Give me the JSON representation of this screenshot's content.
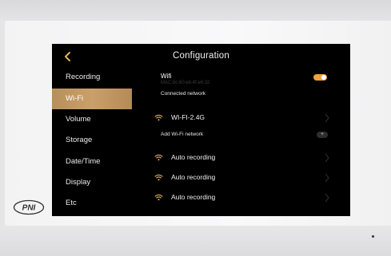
{
  "screen": {
    "title": "Configuration",
    "sidebar": {
      "items": [
        {
          "label": "Recording",
          "active": false
        },
        {
          "label": "Wi-Fi",
          "active": true
        },
        {
          "label": "Volume",
          "active": false
        },
        {
          "label": "Storage",
          "active": false
        },
        {
          "label": "Date/Time",
          "active": false
        },
        {
          "label": "Display",
          "active": false
        },
        {
          "label": "Etc",
          "active": false
        }
      ]
    },
    "wifi": {
      "title": "Wifi",
      "mac": "MAC:8c:60:eb:4f:e6:32",
      "enabled": true,
      "connected_label": "Connected network",
      "connected": {
        "name": "WI-FI-2.4G"
      },
      "add_label": "Add  Wi-Fi network",
      "add_button": "+",
      "available": [
        {
          "name": "Auto recording"
        },
        {
          "name": "Auto recording"
        },
        {
          "name": "Auto recording"
        }
      ]
    }
  },
  "colors": {
    "accent_gold": "#c09564",
    "toggle_on": "#f0a13c",
    "wifi_icon": "#e2b25a",
    "screen_bg": "#000000"
  },
  "icons": {
    "back": "chevron-left-icon",
    "wifi": "wifi-icon",
    "row_arrow": "chevron-right-icon",
    "brand": "pni-logo"
  }
}
